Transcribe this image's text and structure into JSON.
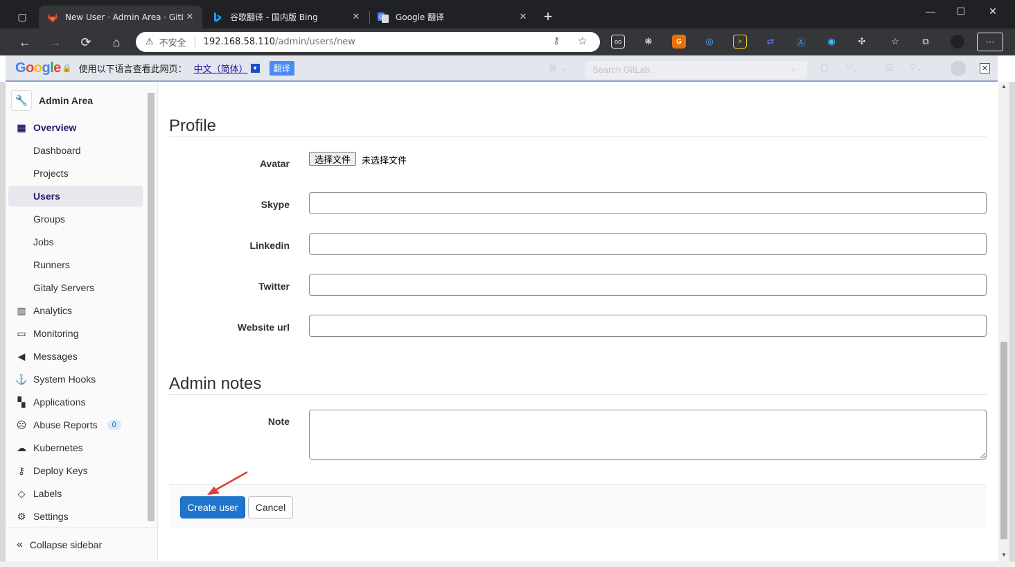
{
  "browser": {
    "tabs": [
      {
        "title": "New User · Admin Area · GitLab",
        "icon": "gitlab-icon",
        "active": true
      },
      {
        "title": "谷歌翻译 - 国内版 Bing",
        "icon": "bing-icon",
        "active": false
      },
      {
        "title": "Google 翻译",
        "icon": "google-translate-icon",
        "active": false
      }
    ],
    "new_tab": "+",
    "window": {
      "minimize": "—",
      "maximize": "☐",
      "close": "✕"
    },
    "address": {
      "insecure_label": "不安全",
      "host": "192.168.58.110",
      "path": "/admin/users/new"
    }
  },
  "translate_bar": {
    "logo": [
      "G",
      "o",
      "o",
      "g",
      "l",
      "e"
    ],
    "prompt": "使用以下语言查看此网页：",
    "language": "中文（简体）",
    "translate_button": "翻译",
    "close": "✕",
    "search_placeholder": "Search GitLab"
  },
  "sidebar": {
    "title": "Admin Area",
    "overview": "Overview",
    "sub_items": [
      "Dashboard",
      "Projects",
      "Users",
      "Groups",
      "Jobs",
      "Runners",
      "Gitaly Servers"
    ],
    "active_item": "Users",
    "items": [
      {
        "label": "Analytics",
        "icon": "chart-icon"
      },
      {
        "label": "Monitoring",
        "icon": "monitor-icon"
      },
      {
        "label": "Messages",
        "icon": "bullhorn-icon"
      },
      {
        "label": "System Hooks",
        "icon": "anchor-icon"
      },
      {
        "label": "Applications",
        "icon": "grid-icon"
      },
      {
        "label": "Abuse Reports",
        "icon": "sad-face-icon",
        "badge": "0"
      },
      {
        "label": "Kubernetes",
        "icon": "cloud-icon"
      },
      {
        "label": "Deploy Keys",
        "icon": "key-icon"
      },
      {
        "label": "Labels",
        "icon": "tag-icon"
      },
      {
        "label": "Settings",
        "icon": "gear-icon"
      }
    ],
    "collapse": "Collapse sidebar"
  },
  "profile": {
    "heading": "Profile",
    "avatar_label": "Avatar",
    "file_button": "选择文件",
    "file_status": "未选择文件",
    "fields": [
      {
        "label": "Skype",
        "value": ""
      },
      {
        "label": "Linkedin",
        "value": ""
      },
      {
        "label": "Twitter",
        "value": ""
      },
      {
        "label": "Website url",
        "value": ""
      }
    ]
  },
  "admin_notes": {
    "heading": "Admin notes",
    "note_label": "Note",
    "note_value": ""
  },
  "actions": {
    "create": "Create user",
    "cancel": "Cancel"
  },
  "colors": {
    "primary_button": "#1f75cb",
    "annotation_arrow": "#e53935"
  }
}
